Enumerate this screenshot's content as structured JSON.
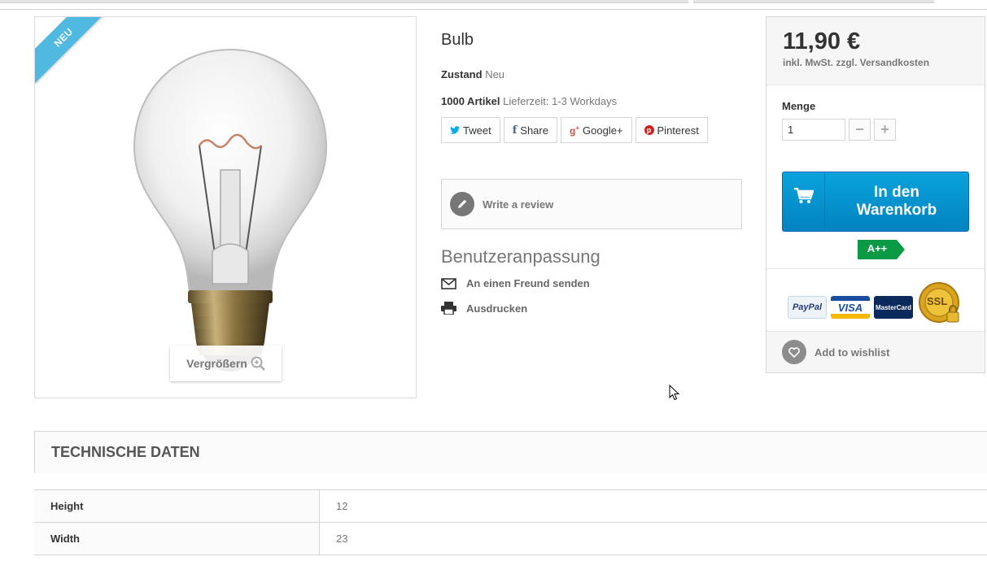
{
  "product": {
    "badge": "NEU",
    "title": "Bulb",
    "condition_label": "Zustand",
    "condition_value": "Neu",
    "stock_label": "1000 Artikel",
    "delivery_text": "Lieferzeit: 1-3 Workdays",
    "zoom_label": "Vergrößern"
  },
  "share": {
    "tweet": "Tweet",
    "facebook": "Share",
    "google": "Google+",
    "pinterest": "Pinterest"
  },
  "review": {
    "label": "Write a review"
  },
  "customization": {
    "title": "Benutzeranpassung",
    "send_friend": "An einen Freund senden",
    "print": "Ausdrucken"
  },
  "buy": {
    "price": "11,90 €",
    "tax_note": "inkl. MwSt. zzgl. Versandkosten",
    "quantity_label": "Menge",
    "quantity_value": "1",
    "cart_label_line1": "In den",
    "cart_label_line2": "Warenkorb",
    "energy_label": "A++",
    "wishlist_label": "Add to wishlist"
  },
  "payment": {
    "paypal": "PayPal",
    "visa": "VISA",
    "mastercard": "MasterCard",
    "ssl": "SSL"
  },
  "tech": {
    "title": "TECHNISCHE DATEN",
    "rows": [
      {
        "key": "Height",
        "value": "12"
      },
      {
        "key": "Width",
        "value": "23"
      }
    ]
  },
  "colors": {
    "accent": "#0aa3dd",
    "ribbon": "#4fb9e0",
    "energy": "#0a9a45"
  }
}
